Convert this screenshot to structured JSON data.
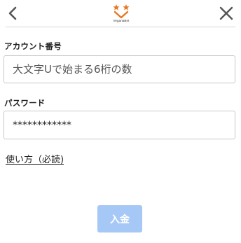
{
  "header": {
    "back_icon": "chevron-left-icon",
    "close_icon": "close-icon",
    "logo_text": "VeganaBet",
    "accent_color": "#e87722"
  },
  "form": {
    "account": {
      "label": "アカウント番号",
      "placeholder": "大文字Uで始まる6桁の数"
    },
    "password": {
      "label": "パスワード",
      "value": "************"
    },
    "howto_link": "使い方（必読)",
    "deposit_button": "入金",
    "deposit_button_color": "#a6c8f6"
  }
}
